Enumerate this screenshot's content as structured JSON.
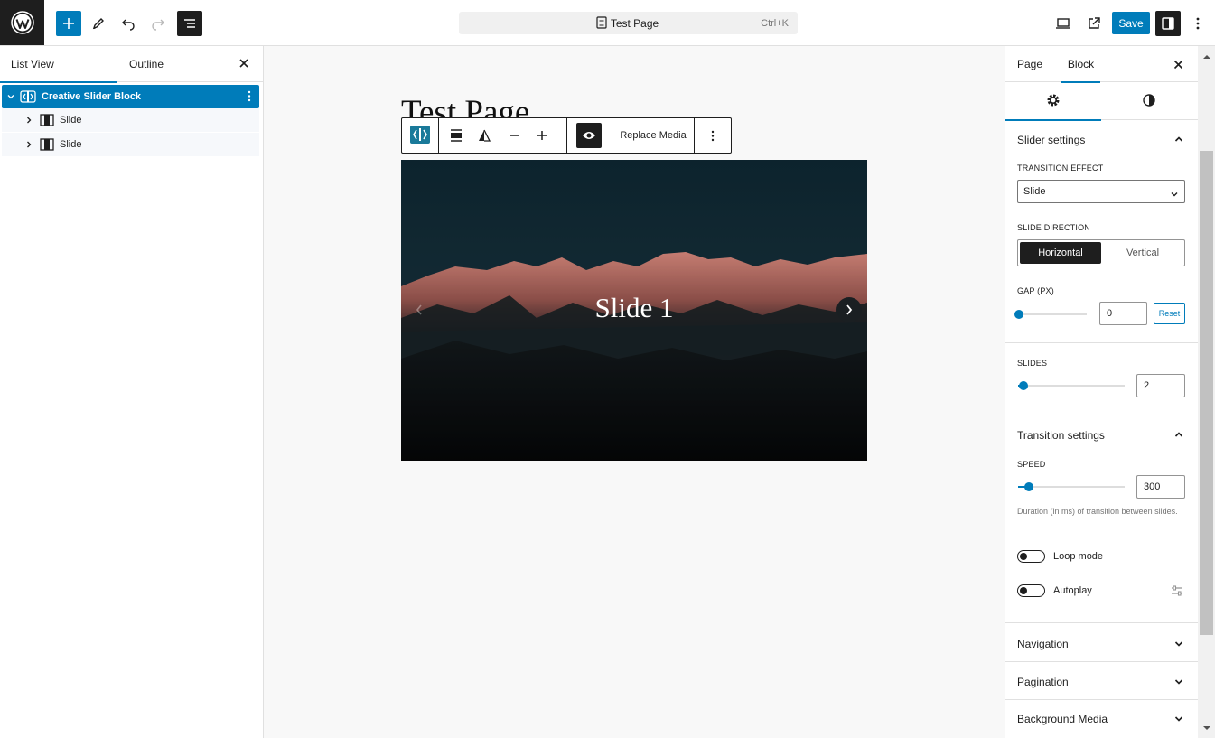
{
  "topbar": {
    "doc_title": "Test Page",
    "shortcut": "Ctrl+K",
    "save_label": "Save"
  },
  "left_panel": {
    "tabs": [
      {
        "label": "List View",
        "active": true
      },
      {
        "label": "Outline",
        "active": false
      }
    ],
    "tree": [
      {
        "label": "Creative Slider Block",
        "selected": true
      },
      {
        "label": "Slide",
        "selected": false
      },
      {
        "label": "Slide",
        "selected": false
      }
    ]
  },
  "canvas": {
    "page_title": "Test Page",
    "toolbar": {
      "replace_media_label": "Replace Media"
    },
    "slide_caption": "Slide 1"
  },
  "sidebar": {
    "tabs": [
      {
        "label": "Page",
        "active": false
      },
      {
        "label": "Block",
        "active": true
      }
    ],
    "slider_settings": {
      "heading": "Slider settings",
      "transition_effect_label": "TRANSITION EFFECT",
      "transition_effect_value": "Slide",
      "slide_direction_label": "SLIDE DIRECTION",
      "direction_options": [
        "Horizontal",
        "Vertical"
      ],
      "direction_selected": "Horizontal",
      "gap_label": "GAP (PX)",
      "gap_value": "0",
      "gap_reset_label": "Reset"
    },
    "slides": {
      "label": "SLIDES",
      "value": "2",
      "range_fraction": 0.05
    },
    "transition_settings": {
      "heading": "Transition settings",
      "speed_label": "SPEED",
      "speed_value": "300",
      "speed_range_fraction": 0.1,
      "speed_help": "Duration (in ms) of transition between slides.",
      "loop_label": "Loop mode",
      "loop_on": false,
      "autoplay_label": "Autoplay",
      "autoplay_on": false
    },
    "collapsed_panels": [
      "Navigation",
      "Pagination",
      "Background Media"
    ]
  },
  "colors": {
    "accent": "#007cba",
    "dark": "#1e1e1e",
    "canvas_bg": "#f8f8f8"
  }
}
